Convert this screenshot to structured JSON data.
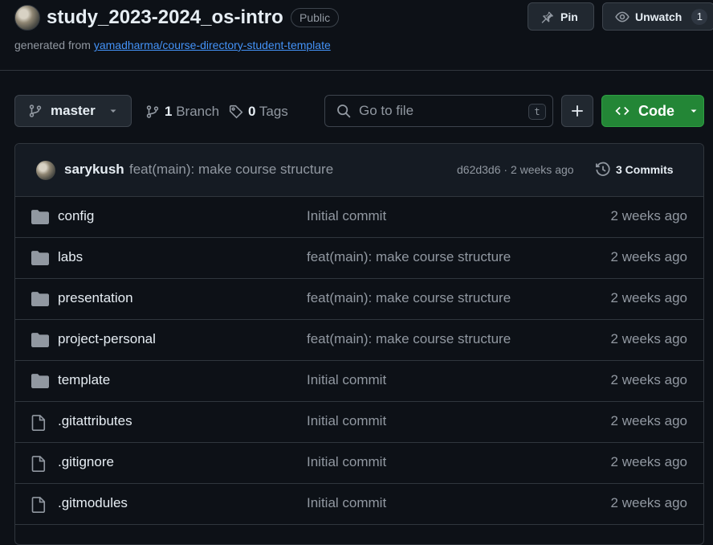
{
  "repo": {
    "name": "study_2023-2024_os-intro",
    "visibility": "Public",
    "generated_prefix": "generated from",
    "template_link": "yamadharma/course-directory-student-template"
  },
  "actions": {
    "pin_label": "Pin",
    "watch_label": "Unwatch",
    "watch_count": "1"
  },
  "toolbar": {
    "branch": "master",
    "branch_count": "1",
    "branch_label": "Branch",
    "tag_count": "0",
    "tag_label": "Tags",
    "search_placeholder": "Go to file",
    "search_shortcut": "t",
    "code_label": "Code"
  },
  "latest_commit": {
    "author": "sarykush",
    "message": "feat(main): make course structure",
    "meta": "d62d3d6 · 2 weeks ago",
    "commits_label": "3 Commits"
  },
  "files": [
    {
      "name": "config",
      "type": "folder",
      "message": "Initial commit",
      "age": "2 weeks ago"
    },
    {
      "name": "labs",
      "type": "folder",
      "message": "feat(main): make course structure",
      "age": "2 weeks ago"
    },
    {
      "name": "presentation",
      "type": "folder",
      "message": "feat(main): make course structure",
      "age": "2 weeks ago"
    },
    {
      "name": "project-personal",
      "type": "folder",
      "message": "feat(main): make course structure",
      "age": "2 weeks ago"
    },
    {
      "name": "template",
      "type": "folder",
      "message": "Initial commit",
      "age": "2 weeks ago"
    },
    {
      "name": ".gitattributes",
      "type": "file",
      "message": "Initial commit",
      "age": "2 weeks ago"
    },
    {
      "name": ".gitignore",
      "type": "file",
      "message": "Initial commit",
      "age": "2 weeks ago"
    },
    {
      "name": ".gitmodules",
      "type": "file",
      "message": "Initial commit",
      "age": "2 weeks ago"
    }
  ],
  "colors": {
    "background": "#0d1117",
    "link": "#4493f8",
    "code_button": "#238636",
    "muted_text": "#9198a1"
  }
}
